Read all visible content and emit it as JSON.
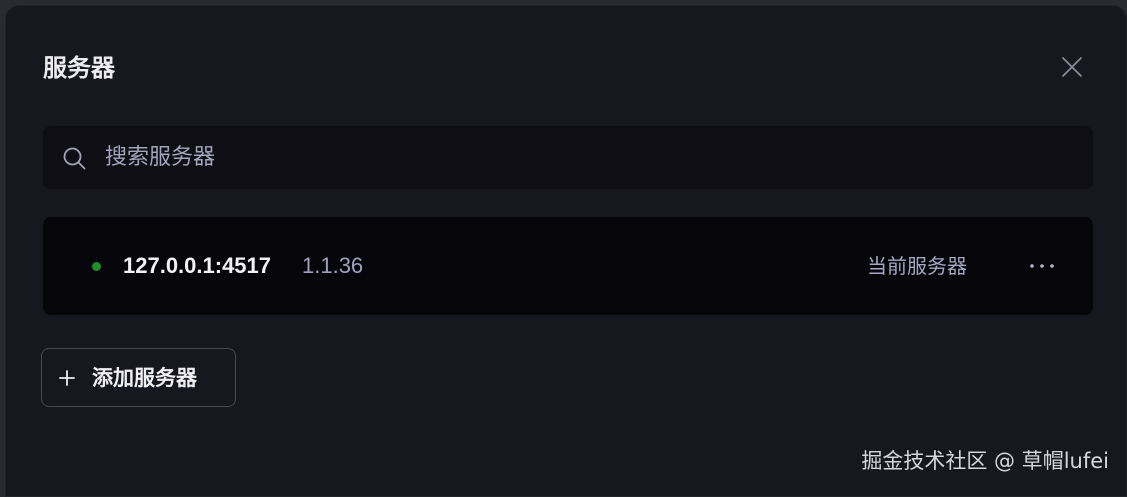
{
  "dialog": {
    "title": "服务器",
    "close_icon": "close-icon"
  },
  "search": {
    "placeholder": "搜索服务器",
    "value": "",
    "icon": "search-icon"
  },
  "servers": [
    {
      "address": "127.0.0.1:4517",
      "version": "1.1.36",
      "status": "online",
      "status_color": "#1f8f2c",
      "current_label": "当前服务器",
      "more_icon": "more-horizontal-icon"
    }
  ],
  "add_server": {
    "label": "添加服务器",
    "icon": "plus-icon"
  },
  "watermark": "掘金技术社区 @ 草帽lufei"
}
